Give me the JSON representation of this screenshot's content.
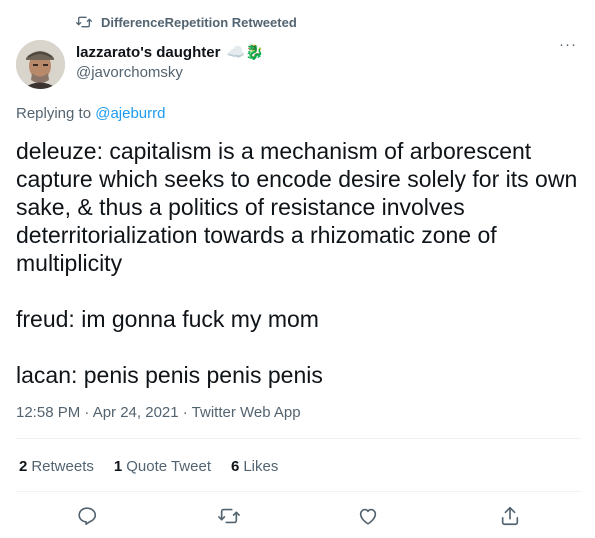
{
  "retweeted_by": "DifferenceRepetition Retweeted",
  "author": {
    "name": "lazzarato's daughter",
    "emoji": "☁️🐉",
    "handle": "@javorchomsky"
  },
  "replying": {
    "prefix": "Replying to ",
    "handle": "@ajeburrd"
  },
  "tweet_text": "deleuze: capitalism is a mechanism of arborescent\ncapture which seeks to encode desire solely for its own\nsake, & thus a politics of resistance involves\ndeterritorialization towards a rhizomatic zone of\nmultiplicity\n\nfreud: im gonna fuck my mom\n\nlacan: penis penis penis penis",
  "meta": "12:58 PM · Apr 24, 2021 · Twitter Web App",
  "stats": {
    "retweets_count": "2",
    "retweets_label": "Retweets",
    "quotes_count": "1",
    "quotes_label": "Quote Tweet",
    "likes_count": "6",
    "likes_label": "Likes"
  },
  "icons": [
    "retweet-icon",
    "more-icon",
    "reply-icon",
    "retweet-icon",
    "like-icon",
    "share-icon"
  ],
  "colors": {
    "link": "#1d9bf0",
    "secondary": "#536471",
    "text": "#0f1419"
  }
}
